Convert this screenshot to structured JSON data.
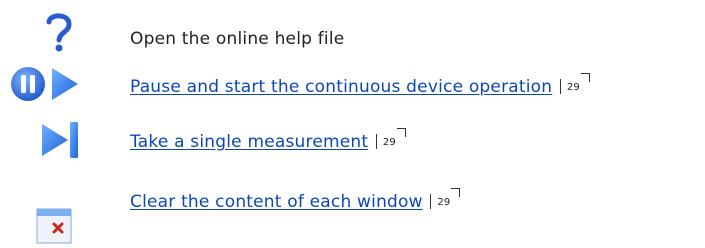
{
  "rows": [
    {
      "icon": "question-mark-icon",
      "text": "Open the online help file"
    },
    {
      "icon": "pause-play-icon",
      "text": "Pause and start the continuous device operation",
      "page": "29"
    },
    {
      "icon": "step-measure-icon",
      "text": "Take a single measurement",
      "page": "29"
    },
    {
      "icon": "clear-window-icon",
      "text": "Clear the content of each window",
      "page": "29"
    }
  ],
  "colors": {
    "link": "#0b47b8",
    "icon_blue": "#1e6fd0"
  }
}
